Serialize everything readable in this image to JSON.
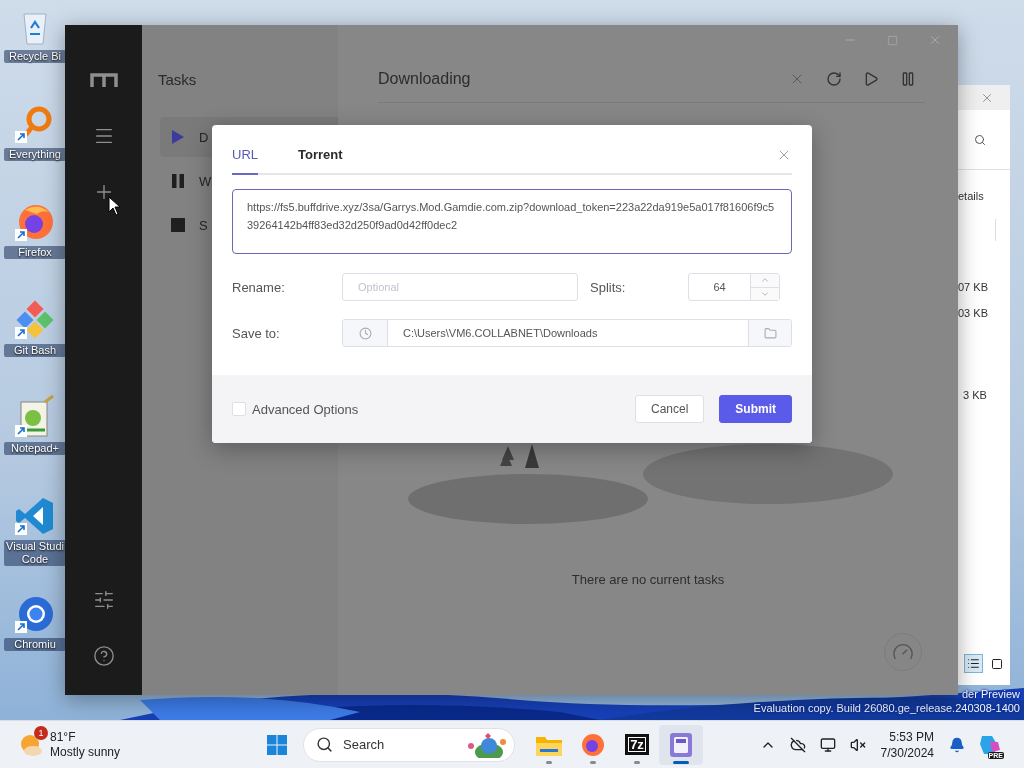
{
  "desktop_icons": [
    {
      "kind": "recycle_bin",
      "label": "Recycle Bi",
      "shortcut": false
    },
    {
      "kind": "search_tool",
      "label": "Everything",
      "shortcut": true
    },
    {
      "kind": "fox_browser",
      "label": "Firefox",
      "shortcut": true
    },
    {
      "kind": "git",
      "label": "Git Bash",
      "shortcut": true
    },
    {
      "kind": "notepad",
      "label": "Notepad+",
      "shortcut": true
    },
    {
      "kind": "code_editor",
      "label": "Visual Studi Code",
      "shortcut": true
    },
    {
      "kind": "round_browser",
      "label": "Chromiu",
      "shortcut": true
    }
  ],
  "explorer_window": {
    "view_label": "etails",
    "sizes": [
      "07 KB",
      "03 KB",
      "3 KB"
    ],
    "views": [
      {
        "kind": "details",
        "selected": true
      },
      {
        "kind": "tiles",
        "selected": false
      }
    ]
  },
  "app": {
    "tasks": {
      "title": "Tasks",
      "items": [
        {
          "kind": "play",
          "label": "D",
          "selected": true
        },
        {
          "kind": "pause",
          "label": "W",
          "selected": false
        },
        {
          "kind": "stop",
          "label": "S",
          "selected": false
        }
      ]
    },
    "main": {
      "title": "Downloading",
      "empty_text": "There are no current tasks"
    }
  },
  "dialog": {
    "tabs": [
      {
        "label": "URL",
        "selected": true
      },
      {
        "label": "Torrent",
        "selected": false
      }
    ],
    "url": "https://fs5.buffdrive.xyz/3sa/Garrys.Mod.Gamdie.com.zip?download_token=223a22da919e5a017f81606f9c539264142b4ff83ed32d250f9ad0d42ff0dec2",
    "rename": {
      "label": "Rename:",
      "placeholder": "Optional"
    },
    "splits": {
      "label": "Splits:",
      "value": "64"
    },
    "save_to": {
      "label": "Save to:",
      "value": "C:\\Users\\VM6.COLLABNET\\Downloads"
    },
    "advanced": {
      "label": "Advanced Options",
      "checked": false
    },
    "buttons": [
      {
        "kind": "secondary",
        "label": "Cancel"
      },
      {
        "kind": "primary",
        "label": "Submit"
      }
    ]
  },
  "watermark": [
    "der Preview",
    "Evaluation copy. Build 26080.ge_release.240308-1400"
  ],
  "taskbar": {
    "weather": {
      "temperature": "81°F",
      "condition": "Mostly sunny",
      "badge": "1"
    },
    "search": {
      "label": "Search"
    },
    "apps": [
      {
        "kind": "files",
        "active": false
      },
      {
        "kind": "fox_browser",
        "active": false
      },
      {
        "kind": "archiver",
        "label": "7z",
        "active": false
      },
      {
        "kind": "downloader",
        "active": true
      }
    ],
    "clock": {
      "time": "5:53 PM",
      "date": "7/30/2024"
    },
    "copilot_badge": "PRE"
  }
}
